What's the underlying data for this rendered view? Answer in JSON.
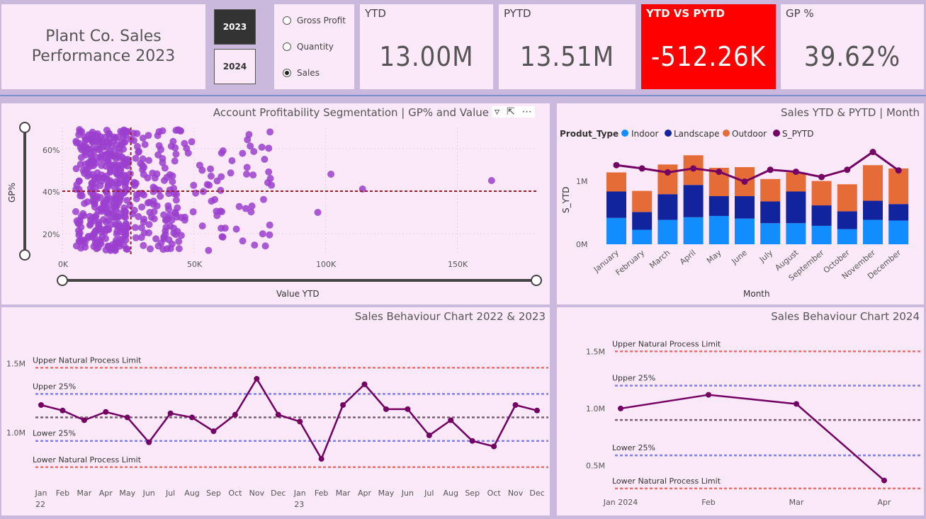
{
  "header": {
    "title": "Plant Co. Sales\nPerformance 2023",
    "years": [
      "2023",
      "2024"
    ],
    "metrics": [
      "Gross Profit",
      "Quantity",
      "Sales"
    ],
    "selected_metric": "Sales"
  },
  "kpis": [
    {
      "label": "YTD",
      "value": "13.00M"
    },
    {
      "label": "PYTD",
      "value": "13.51M"
    },
    {
      "label": "YTD VS PYTD",
      "value": "-512.26K",
      "color": "#fe0000"
    },
    {
      "label": "GP %",
      "value": "39.62%"
    }
  ],
  "colors": {
    "indoor": "#118dff",
    "landscape": "#12239e",
    "outdoor": "#e66c37",
    "pytd": "#750064",
    "scatter": "#9b3fcf",
    "process_limit": "#f26d6d",
    "quartile": "#7f7fee",
    "mean": "#7a6070"
  },
  "scatter_panel": {
    "title": "Account Profitability Segmentation | GP% and Value",
    "xlabel": "Value YTD",
    "ylabel": "GP%",
    "x_ticks": [
      "0K",
      "50K",
      "100K",
      "150K"
    ],
    "y_ticks": [
      "60%",
      "40%",
      "20%"
    ],
    "toolbar": [
      "filter-icon",
      "focus-mode-icon",
      "more-options-icon"
    ]
  },
  "bar_panel": {
    "title": "Sales YTD & PYTD | Month",
    "legend_title": "Produt_Type",
    "ylabel": "S_YTD",
    "xlabel": "Month",
    "y_ticks": [
      "1M",
      "0M"
    ]
  },
  "behaviour_2223": {
    "title": "Sales Behaviour Chart 2022 & 2023",
    "y_ticks": [
      "1.5M",
      "1.0M"
    ],
    "ref_lines": [
      "Upper Natural Process Limit",
      "Upper 25%",
      "Lower 25%",
      "Lower Natural Process Limit"
    ],
    "x_month_labels": [
      "Jan",
      "Feb",
      "Mar",
      "Apr",
      "May",
      "Jun",
      "Jul",
      "Aug",
      "Sep",
      "Oct",
      "Nov",
      "Dec",
      "Jan",
      "Feb",
      "Mar",
      "Apr",
      "May",
      "Jun",
      "Jul",
      "Aug",
      "Sep",
      "Oct",
      "Nov",
      "Dec"
    ],
    "year_labels": [
      "22",
      "23"
    ]
  },
  "behaviour_24": {
    "title": "Sales Behaviour Chart 2024",
    "y_ticks": [
      "1.5M",
      "1.0M",
      "0.5M"
    ],
    "ref_lines": [
      "Upper Natural Process Limit",
      "Upper 25%",
      "Lower 25%",
      "Lower Natural Process Limit"
    ],
    "x_labels": [
      "Jan 2024",
      "Feb",
      "Mar",
      "Apr"
    ]
  },
  "chart_data": [
    {
      "type": "scatter",
      "title": "Account Profitability Segmentation | GP% and Value",
      "xlabel": "Value YTD",
      "ylabel": "GP%",
      "xlim": [
        0,
        180000
      ],
      "ylim": [
        10,
        70
      ],
      "reference_lines": {
        "x_avg": 26000,
        "y_avg": 40
      },
      "outliers": [
        [
          97000,
          30
        ],
        [
          102000,
          48
        ],
        [
          114000,
          41
        ],
        [
          163000,
          45
        ],
        [
          72000,
          33
        ],
        [
          79000,
          46
        ]
      ],
      "cluster": {
        "x_range": [
          3000,
          80000
        ],
        "y_range": [
          10,
          70
        ],
        "approx_points": 550
      }
    },
    {
      "type": "bar",
      "title": "Sales YTD & PYTD | Month",
      "stacked": true,
      "categories": [
        "January",
        "February",
        "March",
        "April",
        "May",
        "June",
        "July",
        "August",
        "September",
        "October",
        "November",
        "December"
      ],
      "series": [
        {
          "name": "Indoor",
          "values": [
            0.4,
            0.22,
            0.37,
            0.41,
            0.43,
            0.39,
            0.32,
            0.32,
            0.28,
            0.23,
            0.37,
            0.36
          ]
        },
        {
          "name": "Landscape",
          "values": [
            0.4,
            0.27,
            0.39,
            0.49,
            0.3,
            0.34,
            0.33,
            0.48,
            0.31,
            0.27,
            0.29,
            0.25
          ]
        },
        {
          "name": "Outdoor",
          "values": [
            0.29,
            0.32,
            0.45,
            0.45,
            0.43,
            0.44,
            0.34,
            0.29,
            0.37,
            0.41,
            0.54,
            0.54
          ]
        },
        {
          "name": "S_PYTD",
          "type": "line",
          "values": [
            1.2,
            1.15,
            1.09,
            1.15,
            1.1,
            0.95,
            1.13,
            1.1,
            1.02,
            1.13,
            1.4,
            1.12
          ]
        }
      ],
      "ylabel": "S_YTD",
      "xlabel": "Month",
      "ylim": [
        0,
        1.6
      ]
    },
    {
      "type": "line",
      "title": "Sales Behaviour Chart 2022 & 2023",
      "x": [
        "Jan 22",
        "Feb 22",
        "Mar 22",
        "Apr 22",
        "May 22",
        "Jun 22",
        "Jul 22",
        "Aug 22",
        "Sep 22",
        "Oct 22",
        "Nov 22",
        "Dec 22",
        "Jan 23",
        "Feb 23",
        "Mar 23",
        "Apr 23",
        "May 23",
        "Jun 23",
        "Jul 23",
        "Aug 23",
        "Sep 23",
        "Oct 23",
        "Nov 23",
        "Dec 23"
      ],
      "values": [
        1.2,
        1.16,
        1.09,
        1.15,
        1.11,
        0.93,
        1.14,
        1.11,
        1.01,
        1.13,
        1.39,
        1.13,
        1.08,
        0.81,
        1.2,
        1.35,
        1.17,
        1.17,
        0.98,
        1.09,
        0.94,
        0.9,
        1.2,
        1.16
      ],
      "reference_lines": {
        "Upper Natural Process Limit": 1.47,
        "Upper 25%": 1.28,
        "Mean": 1.11,
        "Lower 25%": 0.94,
        "Lower Natural Process Limit": 0.75
      },
      "ylim": [
        0.6,
        1.6
      ]
    },
    {
      "type": "line",
      "title": "Sales Behaviour Chart 2024",
      "x": [
        "Jan 2024",
        "Feb",
        "Mar",
        "Apr"
      ],
      "values": [
        1.0,
        1.12,
        1.04,
        0.37
      ],
      "reference_lines": {
        "Upper Natural Process Limit": 1.5,
        "Upper 25%": 1.2,
        "Mean": 0.9,
        "Lower 25%": 0.59,
        "Lower Natural Process Limit": 0.3
      },
      "ylim": [
        0.2,
        1.7
      ]
    }
  ]
}
